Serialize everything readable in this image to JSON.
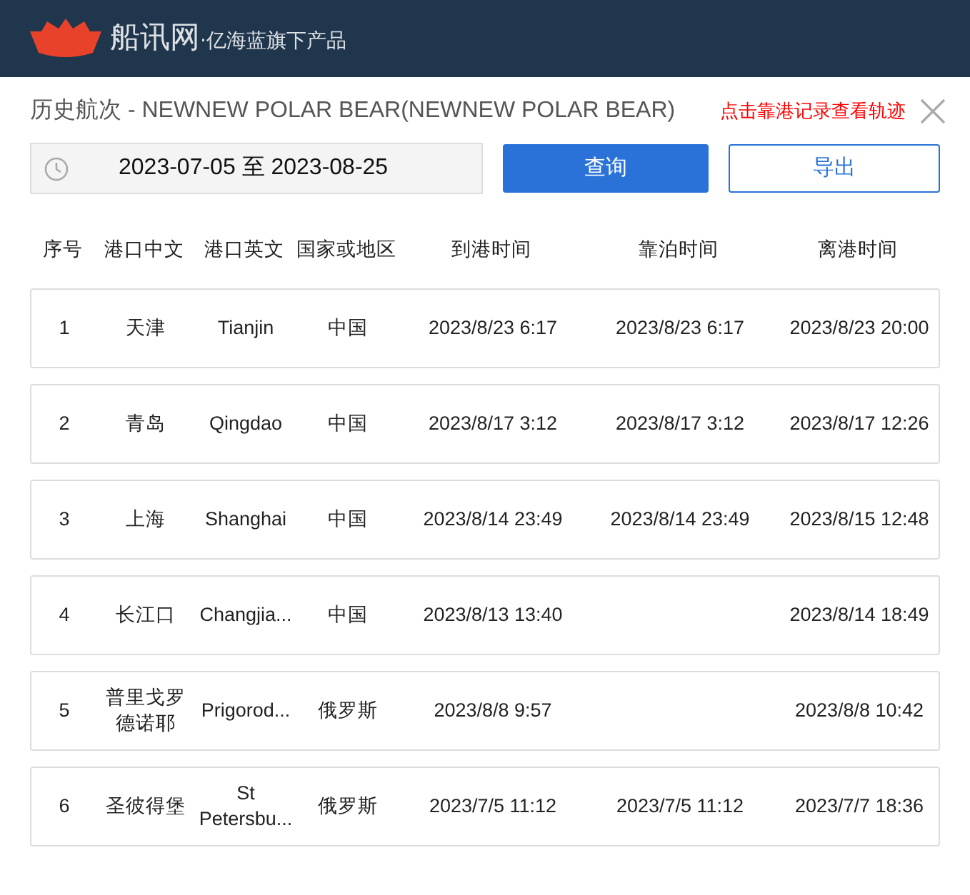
{
  "header": {
    "brand": "船讯网",
    "tagline": "·亿海蓝旗下产品"
  },
  "dialog": {
    "title": "历史航次 - NEWNEW POLAR BEAR(NEWNEW POLAR BEAR)",
    "hint": "点击靠港记录查看轨迹"
  },
  "filter": {
    "date_range": "2023-07-05 至 2023-08-25",
    "query_button": "查询",
    "export_button": "导出"
  },
  "table": {
    "columns": [
      "序号",
      "港口中文",
      "港口英文",
      "国家或地区",
      "到港时间",
      "靠泊时间",
      "离港时间"
    ],
    "rows": [
      {
        "index": "1",
        "port_cn": "天津",
        "port_en": "Tianjin",
        "country": "中国",
        "arrival": "2023/8/23 6:17",
        "berth": "2023/8/23 6:17",
        "departure": "2023/8/23 20:00"
      },
      {
        "index": "2",
        "port_cn": "青岛",
        "port_en": "Qingdao",
        "country": "中国",
        "arrival": "2023/8/17 3:12",
        "berth": "2023/8/17 3:12",
        "departure": "2023/8/17 12:26"
      },
      {
        "index": "3",
        "port_cn": "上海",
        "port_en": "Shanghai",
        "country": "中国",
        "arrival": "2023/8/14 23:49",
        "berth": "2023/8/14 23:49",
        "departure": "2023/8/15 12:48"
      },
      {
        "index": "4",
        "port_cn": "长江口",
        "port_en": "Changjia...",
        "country": "中国",
        "arrival": "2023/8/13 13:40",
        "departure": "2023/8/14 18:49"
      },
      {
        "index": "5",
        "port_cn": "普里戈罗德诺耶",
        "port_en": "Prigorod...",
        "country": "俄罗斯",
        "arrival": "2023/8/8 9:57",
        "departure": "2023/8/8 10:42"
      },
      {
        "index": "6",
        "port_cn": "圣彼得堡",
        "port_en": "St Petersbu...",
        "country": "俄罗斯",
        "arrival": "2023/7/5 11:12",
        "berth": "2023/7/5 11:12",
        "departure": "2023/7/7 18:36"
      }
    ]
  }
}
